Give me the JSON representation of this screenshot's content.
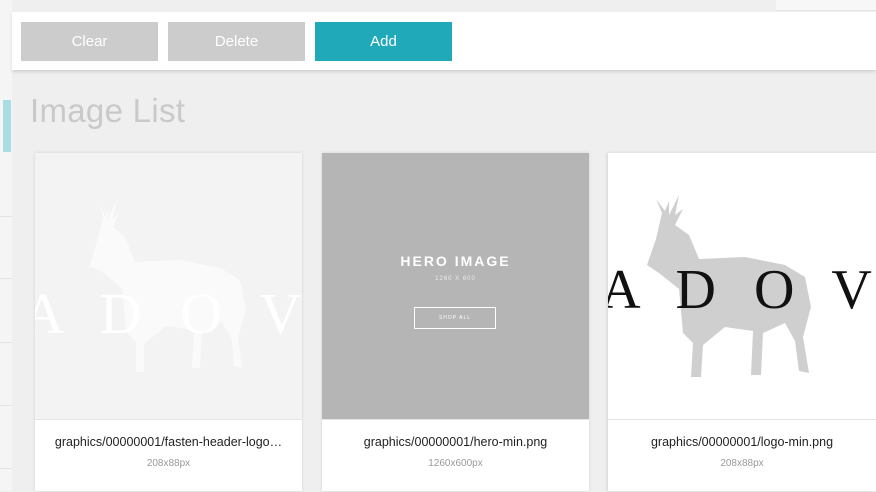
{
  "toolbar": {
    "clear_label": "Clear",
    "delete_label": "Delete",
    "add_label": "Add"
  },
  "page_title": "Image List",
  "colors": {
    "accent": "#20a9b9",
    "disabled_button": "#cccccc"
  },
  "images": [
    {
      "filename": "graphics/00000001/fasten-header-logo…",
      "dimensions": "208x88px",
      "thumbnail_icon": "deer-logo-icon",
      "thumbnail_text": "A D O V"
    },
    {
      "filename": "graphics/00000001/hero-min.png",
      "dimensions": "1260x600px",
      "hero_title": "HERO IMAGE",
      "hero_size": "1260 X 600",
      "hero_button": "SHOP ALL"
    },
    {
      "filename": "graphics/00000001/logo-min.png",
      "dimensions": "208x88px",
      "thumbnail_icon": "deer-logo-icon",
      "thumbnail_text": "A D O V"
    }
  ]
}
